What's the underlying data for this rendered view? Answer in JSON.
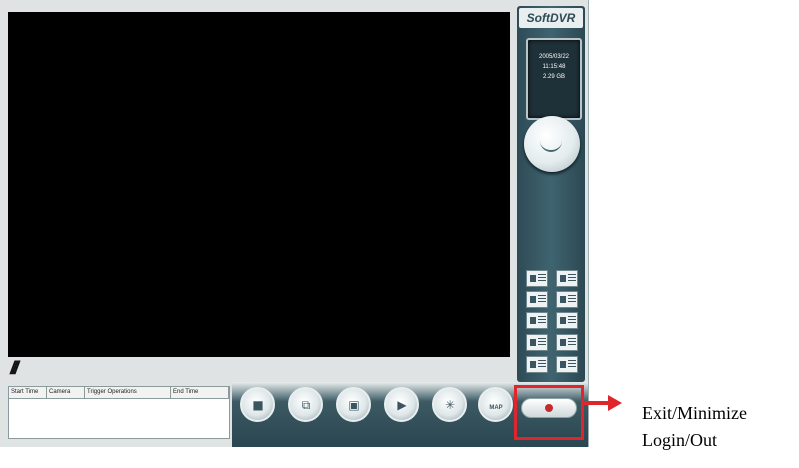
{
  "brand": "SoftDVR",
  "info": {
    "date": "2005/03/22",
    "time": "11:15:48",
    "disk": "2.29 GB"
  },
  "overlay_mark": "///",
  "event_log": {
    "columns": [
      "Start Time",
      "Camera",
      "Trigger Operations",
      "End Time"
    ]
  },
  "controls": [
    {
      "name": "stop-record-icon",
      "glyph": "■"
    },
    {
      "name": "window-icon",
      "glyph": "⧉"
    },
    {
      "name": "camera-view-icon",
      "glyph": "▣"
    },
    {
      "name": "play-icon",
      "glyph": "▶"
    },
    {
      "name": "ptz-icon",
      "glyph": "✳"
    },
    {
      "name": "map-icon",
      "glyph": "MAP"
    }
  ],
  "annotation": {
    "line1": "Exit/Minimize",
    "line2": "Login/Out"
  },
  "colors": {
    "panel": "#2e4b56",
    "highlight": "#e0262d"
  }
}
